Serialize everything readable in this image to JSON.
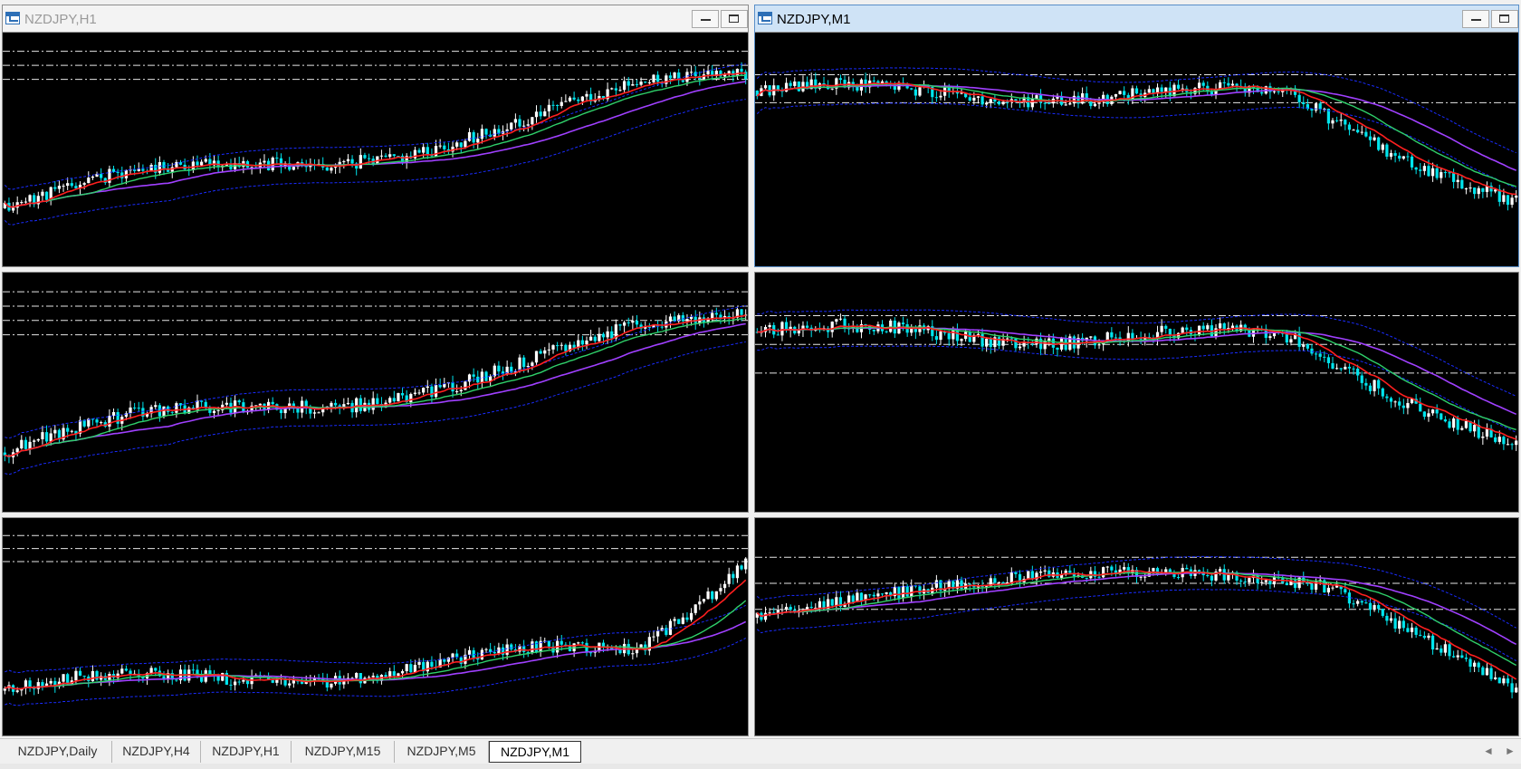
{
  "windows": [
    {
      "id": "h1",
      "title": "NZDJPY,H1",
      "active": false,
      "has_titlebar": true
    },
    {
      "id": "m1",
      "title": "NZDJPY,M1",
      "active": true,
      "has_titlebar": true
    },
    {
      "id": "mid-left",
      "title": "",
      "active": false,
      "has_titlebar": false
    },
    {
      "id": "mid-right",
      "title": "",
      "active": false,
      "has_titlebar": false
    },
    {
      "id": "bot-left",
      "title": "",
      "active": false,
      "has_titlebar": false
    },
    {
      "id": "bot-right",
      "title": "",
      "active": false,
      "has_titlebar": false
    }
  ],
  "tabs": [
    {
      "label": "NZDJPY,Daily",
      "active": false
    },
    {
      "label": "NZDJPY,H4",
      "active": false
    },
    {
      "label": "NZDJPY,H1",
      "active": false
    },
    {
      "label": "NZDJPY,M15",
      "active": false
    },
    {
      "label": "NZDJPY,M5",
      "active": false
    },
    {
      "label": "NZDJPY,M1",
      "active": true
    }
  ],
  "tab_nav": {
    "left_arrow": "◄",
    "right_arrow": "►"
  },
  "colors": {
    "chart_bg": "#000000",
    "bull_candle": "#ffffff",
    "bear_candle": "#00e5ee",
    "ma_fast": "#ff1f1f",
    "ma_mid": "#2fd06a",
    "ma_slow": "#a040ff",
    "envelope": "#1a2cff",
    "level_line": "#ffffff",
    "active_title": "#cfe3f6"
  }
}
